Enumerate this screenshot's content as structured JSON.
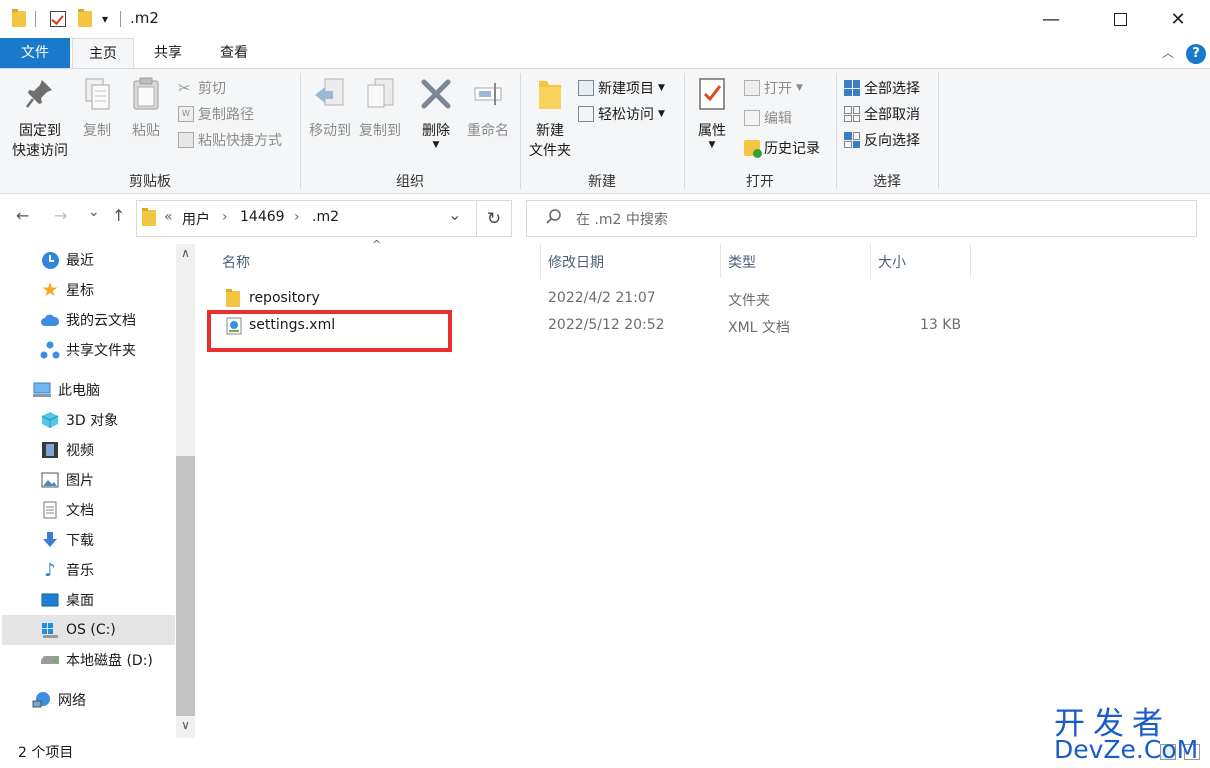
{
  "window": {
    "title": ".m2",
    "minimize_glyph": "—",
    "maximize_glyph": "☐",
    "close_glyph": "✕"
  },
  "quick_access": {
    "dropdown_glyph": "▾"
  },
  "ribbon_tabs": {
    "file": "文件",
    "home": "主页",
    "share": "共享",
    "view": "查看",
    "help": "?",
    "collapse_glyph": "︿"
  },
  "ribbon": {
    "clipboard": {
      "group_label": "剪贴板",
      "pin_line1": "固定到",
      "pin_line2": "快速访问",
      "copy": "复制",
      "paste": "粘贴",
      "cut": "剪切",
      "copy_path": "复制路径",
      "paste_shortcut": "粘贴快捷方式"
    },
    "organize": {
      "group_label": "组织",
      "move_to": "移动到",
      "copy_to": "复制到",
      "delete": "删除",
      "rename": "重命名"
    },
    "new": {
      "group_label": "新建",
      "new_folder_line1": "新建",
      "new_folder_line2": "文件夹",
      "new_item": "新建项目",
      "easy_access": "轻松访问"
    },
    "open": {
      "group_label": "打开",
      "properties": "属性",
      "open": "打开",
      "edit": "编辑",
      "history": "历史记录"
    },
    "select": {
      "group_label": "选择",
      "select_all": "全部选择",
      "select_none": "全部取消",
      "invert": "反向选择"
    }
  },
  "address_bar": {
    "back": "←",
    "forward": "→",
    "recent": "⌄",
    "up": "↑",
    "overflow": "«",
    "crumbs": [
      "用户",
      "14469",
      ".m2"
    ],
    "crumb_sep": "›",
    "dropdown": "⌄",
    "refresh": "↻",
    "search_placeholder": "在 .m2 中搜索"
  },
  "nav_pane": {
    "items": [
      {
        "label": "最近",
        "icon": "clock-icon"
      },
      {
        "label": "星标",
        "icon": "star-icon"
      },
      {
        "label": "我的云文档",
        "icon": "cloud-icon"
      },
      {
        "label": "共享文件夹",
        "icon": "share-icon"
      },
      {
        "label": "此电脑",
        "icon": "computer-icon"
      },
      {
        "label": "3D 对象",
        "icon": "cube-icon"
      },
      {
        "label": "视频",
        "icon": "video-icon"
      },
      {
        "label": "图片",
        "icon": "picture-icon"
      },
      {
        "label": "文档",
        "icon": "document-icon"
      },
      {
        "label": "下载",
        "icon": "download-icon"
      },
      {
        "label": "音乐",
        "icon": "music-icon"
      },
      {
        "label": "桌面",
        "icon": "desktop-icon"
      },
      {
        "label": "OS (C:)",
        "icon": "drive-c-icon"
      },
      {
        "label": "本地磁盘 (D:)",
        "icon": "drive-d-icon"
      },
      {
        "label": "网络",
        "icon": "network-icon"
      }
    ],
    "selected": "OS (C:)"
  },
  "file_list": {
    "columns": {
      "name": "名称",
      "modified": "修改日期",
      "type": "类型",
      "size": "大小"
    },
    "sort_glyph": "^",
    "rows": [
      {
        "name": "repository",
        "modified": "2022/4/2 21:07",
        "type": "文件夹",
        "size": "",
        "icon": "folder-icon"
      },
      {
        "name": "settings.xml",
        "modified": "2022/5/12 20:52",
        "type": "XML 文档",
        "size": "13 KB",
        "icon": "xml-file-icon"
      }
    ]
  },
  "status_bar": {
    "item_count": "2 个项目"
  },
  "watermark": {
    "line1": "开发者",
    "line2": "DevZe.CoM"
  },
  "colors": {
    "accent": "#1979ca",
    "highlight_box": "#e8302f",
    "folder": "#f4c542"
  }
}
